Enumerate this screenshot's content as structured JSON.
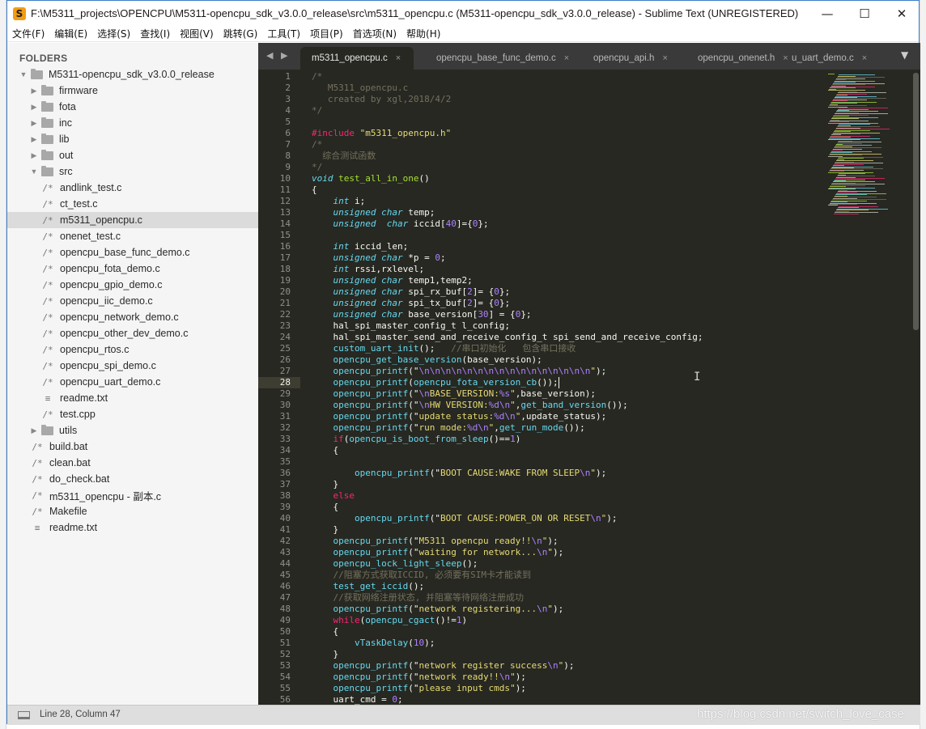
{
  "window": {
    "title": "F:\\M5311_projects\\OPENCPU\\M5311-opencpu_sdk_v3.0.0_release\\src\\m5311_opencpu.c (M5311-opencpu_sdk_v3.0.0_release) - Sublime Text (UNREGISTERED)",
    "minimize_icon": "minimize-icon",
    "maximize_icon": "maximize-icon",
    "close_icon": "close-icon"
  },
  "menu": [
    "文件(F)",
    "编辑(E)",
    "选择(S)",
    "查找(I)",
    "视图(V)",
    "跳转(G)",
    "工具(T)",
    "项目(P)",
    "首选项(N)",
    "帮助(H)"
  ],
  "sidebar": {
    "heading": "FOLDERS",
    "items": [
      {
        "label": "M5311-opencpu_sdk_v3.0.0_release",
        "kind": "folder",
        "open": true,
        "depth": 0
      },
      {
        "label": "firmware",
        "kind": "folder",
        "open": false,
        "depth": 1
      },
      {
        "label": "fota",
        "kind": "folder",
        "open": false,
        "depth": 1
      },
      {
        "label": "inc",
        "kind": "folder",
        "open": false,
        "depth": 1
      },
      {
        "label": "lib",
        "kind": "folder",
        "open": false,
        "depth": 1
      },
      {
        "label": "out",
        "kind": "folder",
        "open": false,
        "depth": 1
      },
      {
        "label": "src",
        "kind": "folder",
        "open": true,
        "depth": 1
      },
      {
        "label": "andlink_test.c",
        "kind": "c",
        "depth": 2
      },
      {
        "label": "ct_test.c",
        "kind": "c",
        "depth": 2
      },
      {
        "label": "m5311_opencpu.c",
        "kind": "c",
        "depth": 2,
        "selected": true
      },
      {
        "label": "onenet_test.c",
        "kind": "c",
        "depth": 2
      },
      {
        "label": "opencpu_base_func_demo.c",
        "kind": "c",
        "depth": 2
      },
      {
        "label": "opencpu_fota_demo.c",
        "kind": "c",
        "depth": 2
      },
      {
        "label": "opencpu_gpio_demo.c",
        "kind": "c",
        "depth": 2
      },
      {
        "label": "opencpu_iic_demo.c",
        "kind": "c",
        "depth": 2
      },
      {
        "label": "opencpu_network_demo.c",
        "kind": "c",
        "depth": 2
      },
      {
        "label": "opencpu_other_dev_demo.c",
        "kind": "c",
        "depth": 2
      },
      {
        "label": "opencpu_rtos.c",
        "kind": "c",
        "depth": 2
      },
      {
        "label": "opencpu_spi_demo.c",
        "kind": "c",
        "depth": 2
      },
      {
        "label": "opencpu_uart_demo.c",
        "kind": "c",
        "depth": 2
      },
      {
        "label": "readme.txt",
        "kind": "txt",
        "depth": 2
      },
      {
        "label": "test.cpp",
        "kind": "c",
        "depth": 2
      },
      {
        "label": "utils",
        "kind": "folder",
        "open": false,
        "depth": 1
      },
      {
        "label": "build.bat",
        "kind": "c",
        "depth": 1
      },
      {
        "label": "clean.bat",
        "kind": "c",
        "depth": 1
      },
      {
        "label": "do_check.bat",
        "kind": "c",
        "depth": 1
      },
      {
        "label": "m5311_opencpu - 副本.c",
        "kind": "c",
        "depth": 1
      },
      {
        "label": "Makefile",
        "kind": "c",
        "depth": 1
      },
      {
        "label": "readme.txt",
        "kind": "txt",
        "depth": 1
      }
    ]
  },
  "tabs": [
    {
      "label": "m5311_opencpu.c",
      "active": true
    },
    {
      "label": "opencpu_base_func_demo.c",
      "active": false
    },
    {
      "label": "opencpu_api.h",
      "active": false
    },
    {
      "label": "opencpu_onenet.h",
      "active": false
    },
    {
      "label": "u_uart_demo.c",
      "active": false
    }
  ],
  "tab_nav": "◀ ▶",
  "tab_dropdown_icon": "dropdown-triangle-icon",
  "editor": {
    "current_line": 28,
    "lines": [
      [
        [
          "cm",
          "/*"
        ]
      ],
      [
        [
          "cm",
          "   M5311_opencpu.c"
        ]
      ],
      [
        [
          "cm",
          "   created by xgl,2018/4/2"
        ]
      ],
      [
        [
          "cm",
          "*/"
        ]
      ],
      [],
      [
        [
          "kw",
          "#include "
        ],
        [
          "st",
          "\"m5311_opencpu.h\""
        ]
      ],
      [
        [
          "cm",
          "/*"
        ]
      ],
      [
        [
          "cm",
          "  综合测试函数"
        ]
      ],
      [
        [
          "cm",
          "*/"
        ]
      ],
      [
        [
          "ty",
          "void "
        ],
        [
          "fn",
          "test_all_in_one"
        ],
        [
          "",
          "()"
        ]
      ],
      [
        [
          "",
          "{"
        ]
      ],
      [
        [
          "",
          "    "
        ],
        [
          "ty",
          "int"
        ],
        [
          "",
          " i;"
        ]
      ],
      [
        [
          "",
          "    "
        ],
        [
          "ty",
          "unsigned char"
        ],
        [
          "",
          " temp;"
        ]
      ],
      [
        [
          "",
          "    "
        ],
        [
          "ty",
          "unsigned  char"
        ],
        [
          "",
          " iccid["
        ],
        [
          "nm",
          "40"
        ],
        [
          "",
          "]={"
        ],
        [
          "nm",
          "0"
        ],
        [
          "",
          "};"
        ]
      ],
      [],
      [
        [
          "",
          "    "
        ],
        [
          "ty",
          "int"
        ],
        [
          "",
          " iccid_len;"
        ]
      ],
      [
        [
          "",
          "    "
        ],
        [
          "ty",
          "unsigned char"
        ],
        [
          "",
          " *p = "
        ],
        [
          "nm",
          "0"
        ],
        [
          "",
          ";"
        ]
      ],
      [
        [
          "",
          "    "
        ],
        [
          "ty",
          "int"
        ],
        [
          "",
          " rssi,rxlevel;"
        ]
      ],
      [
        [
          "",
          "    "
        ],
        [
          "ty",
          "unsigned char"
        ],
        [
          "",
          " temp1,temp2;"
        ]
      ],
      [
        [
          "",
          "    "
        ],
        [
          "ty",
          "unsigned char"
        ],
        [
          "",
          " spi_rx_buf["
        ],
        [
          "nm",
          "2"
        ],
        [
          "",
          "]= {"
        ],
        [
          "nm",
          "0"
        ],
        [
          "",
          "};"
        ]
      ],
      [
        [
          "",
          "    "
        ],
        [
          "ty",
          "unsigned char"
        ],
        [
          "",
          " spi_tx_buf["
        ],
        [
          "nm",
          "2"
        ],
        [
          "",
          "]= {"
        ],
        [
          "nm",
          "0"
        ],
        [
          "",
          "};"
        ]
      ],
      [
        [
          "",
          "    "
        ],
        [
          "ty",
          "unsigned char"
        ],
        [
          "",
          " base_version["
        ],
        [
          "nm",
          "30"
        ],
        [
          "",
          "] = {"
        ],
        [
          "nm",
          "0"
        ],
        [
          "",
          "};"
        ]
      ],
      [
        [
          "",
          "    hal_spi_master_config_t l_config;"
        ]
      ],
      [
        [
          "",
          "    hal_spi_master_send_and_receive_config_t spi_send_and_receive_config;"
        ]
      ],
      [
        [
          "",
          "    "
        ],
        [
          "fnc",
          "custom_uart_init"
        ],
        [
          "",
          "();   "
        ],
        [
          "cm",
          "//串口初始化   包含串口接收"
        ]
      ],
      [
        [
          "",
          "    "
        ],
        [
          "fnc",
          "opencpu_get_base_version"
        ],
        [
          "",
          "(base_version);"
        ]
      ],
      [
        [
          "",
          "    "
        ],
        [
          "fnc",
          "opencpu_printf"
        ],
        [
          "",
          "(\""
        ],
        [
          "es",
          "\\n\\n\\n\\n\\n\\n\\n\\n\\n\\n\\n\\n\\n\\n\\n\\n"
        ],
        [
          "st",
          "\""
        ],
        [
          "",
          ");"
        ]
      ],
      [
        [
          "",
          "    "
        ],
        [
          "fnc",
          "opencpu_printf"
        ],
        [
          "",
          "("
        ],
        [
          "fnc",
          "opencpu_fota_version_cb"
        ],
        [
          "",
          "());"
        ]
      ],
      [
        [
          "",
          "    "
        ],
        [
          "fnc",
          "opencpu_printf"
        ],
        [
          "",
          "(\""
        ],
        [
          "es",
          "\\n"
        ],
        [
          "st",
          "BASE_VERSION:"
        ],
        [
          "es",
          "%s"
        ],
        [
          "st",
          "\""
        ],
        [
          "",
          ",base_version);"
        ]
      ],
      [
        [
          "",
          "    "
        ],
        [
          "fnc",
          "opencpu_printf"
        ],
        [
          "",
          "(\""
        ],
        [
          "es",
          "\\n"
        ],
        [
          "st",
          "HW VERSION:"
        ],
        [
          "es",
          "%d\\n"
        ],
        [
          "st",
          "\""
        ],
        [
          "",
          ","
        ],
        [
          "fnc",
          "get_band_version"
        ],
        [
          "",
          "());"
        ]
      ],
      [
        [
          "",
          "    "
        ],
        [
          "fnc",
          "opencpu_printf"
        ],
        [
          "",
          "(\""
        ],
        [
          "st",
          "update status:"
        ],
        [
          "es",
          "%d\\n"
        ],
        [
          "st",
          "\""
        ],
        [
          "",
          ",update_status);"
        ]
      ],
      [
        [
          "",
          "    "
        ],
        [
          "fnc",
          "opencpu_printf"
        ],
        [
          "",
          "(\""
        ],
        [
          "st",
          "run mode:"
        ],
        [
          "es",
          "%d\\n"
        ],
        [
          "st",
          "\""
        ],
        [
          "",
          ","
        ],
        [
          "fnc",
          "get_run_mode"
        ],
        [
          "",
          "());"
        ]
      ],
      [
        [
          "",
          "    "
        ],
        [
          "kw",
          "if"
        ],
        [
          "",
          "("
        ],
        [
          "fnc",
          "opencpu_is_boot_from_sleep"
        ],
        [
          "",
          "()=="
        ],
        [
          "nm",
          "1"
        ],
        [
          "",
          ")"
        ]
      ],
      [
        [
          "",
          "    {"
        ]
      ],
      [],
      [
        [
          "",
          "        "
        ],
        [
          "fnc",
          "opencpu_printf"
        ],
        [
          "",
          "(\""
        ],
        [
          "st",
          "BOOT CAUSE:WAKE FROM SLEEP"
        ],
        [
          "es",
          "\\n"
        ],
        [
          "st",
          "\""
        ],
        [
          "",
          ");"
        ]
      ],
      [
        [
          "",
          "    }"
        ]
      ],
      [
        [
          "",
          "    "
        ],
        [
          "kw",
          "else"
        ]
      ],
      [
        [
          "",
          "    {"
        ]
      ],
      [
        [
          "",
          "        "
        ],
        [
          "fnc",
          "opencpu_printf"
        ],
        [
          "",
          "(\""
        ],
        [
          "st",
          "BOOT CAUSE:POWER_ON OR RESET"
        ],
        [
          "es",
          "\\n"
        ],
        [
          "st",
          "\""
        ],
        [
          "",
          ");"
        ]
      ],
      [
        [
          "",
          "    }"
        ]
      ],
      [
        [
          "",
          "    "
        ],
        [
          "fnc",
          "opencpu_printf"
        ],
        [
          "",
          "(\""
        ],
        [
          "st",
          "M5311 opencpu ready!!"
        ],
        [
          "es",
          "\\n"
        ],
        [
          "st",
          "\""
        ],
        [
          "",
          ");"
        ]
      ],
      [
        [
          "",
          "    "
        ],
        [
          "fnc",
          "opencpu_printf"
        ],
        [
          "",
          "(\""
        ],
        [
          "st",
          "waiting for network..."
        ],
        [
          "es",
          "\\n"
        ],
        [
          "st",
          "\""
        ],
        [
          "",
          ");"
        ]
      ],
      [
        [
          "",
          "    "
        ],
        [
          "fnc",
          "opencpu_lock_light_sleep"
        ],
        [
          "",
          "();"
        ]
      ],
      [
        [
          "",
          "    "
        ],
        [
          "cm",
          "//阻塞方式获取ICCID, 必须要有SIM卡才能读到"
        ]
      ],
      [
        [
          "",
          "    "
        ],
        [
          "fnc",
          "test_get_iccid"
        ],
        [
          "",
          "();"
        ]
      ],
      [
        [
          "",
          "    "
        ],
        [
          "cm",
          "//获取网络注册状态, 并阻塞等待网络注册成功"
        ]
      ],
      [
        [
          "",
          "    "
        ],
        [
          "fnc",
          "opencpu_printf"
        ],
        [
          "",
          "(\""
        ],
        [
          "st",
          "network registering..."
        ],
        [
          "es",
          "\\n"
        ],
        [
          "st",
          "\""
        ],
        [
          "",
          ");"
        ]
      ],
      [
        [
          "",
          "    "
        ],
        [
          "kw",
          "while"
        ],
        [
          "",
          "("
        ],
        [
          "fnc",
          "opencpu_cgact"
        ],
        [
          "",
          "()!="
        ],
        [
          "nm",
          "1"
        ],
        [
          "",
          ")"
        ]
      ],
      [
        [
          "",
          "    {"
        ]
      ],
      [
        [
          "",
          "        "
        ],
        [
          "fnc",
          "vTaskDelay"
        ],
        [
          "",
          "("
        ],
        [
          "nm",
          "10"
        ],
        [
          "",
          ");"
        ]
      ],
      [
        [
          "",
          "    }"
        ]
      ],
      [
        [
          "",
          "    "
        ],
        [
          "fnc",
          "opencpu_printf"
        ],
        [
          "",
          "(\""
        ],
        [
          "st",
          "network register success"
        ],
        [
          "es",
          "\\n"
        ],
        [
          "st",
          "\""
        ],
        [
          "",
          ");"
        ]
      ],
      [
        [
          "",
          "    "
        ],
        [
          "fnc",
          "opencpu_printf"
        ],
        [
          "",
          "(\""
        ],
        [
          "st",
          "network ready!!"
        ],
        [
          "es",
          "\\n"
        ],
        [
          "st",
          "\""
        ],
        [
          "",
          ");"
        ]
      ],
      [
        [
          "",
          "    "
        ],
        [
          "fnc",
          "opencpu_printf"
        ],
        [
          "",
          "(\""
        ],
        [
          "st",
          "please input cmds"
        ],
        [
          "st",
          "\""
        ],
        [
          "",
          ");"
        ]
      ],
      [
        [
          "",
          "    uart_cmd = "
        ],
        [
          "nm",
          "0"
        ],
        [
          "",
          ";"
        ]
      ]
    ]
  },
  "status": {
    "text": "Line 28, Column 47",
    "watermark": "https://blog.csdn.net/switch_love_case"
  },
  "colors": {
    "editor_bg": "#272822",
    "comment": "#75715e",
    "keyword": "#f92672",
    "type": "#66d9ef",
    "string": "#e6db74",
    "number": "#ae81ff",
    "function": "#a6e22e"
  }
}
